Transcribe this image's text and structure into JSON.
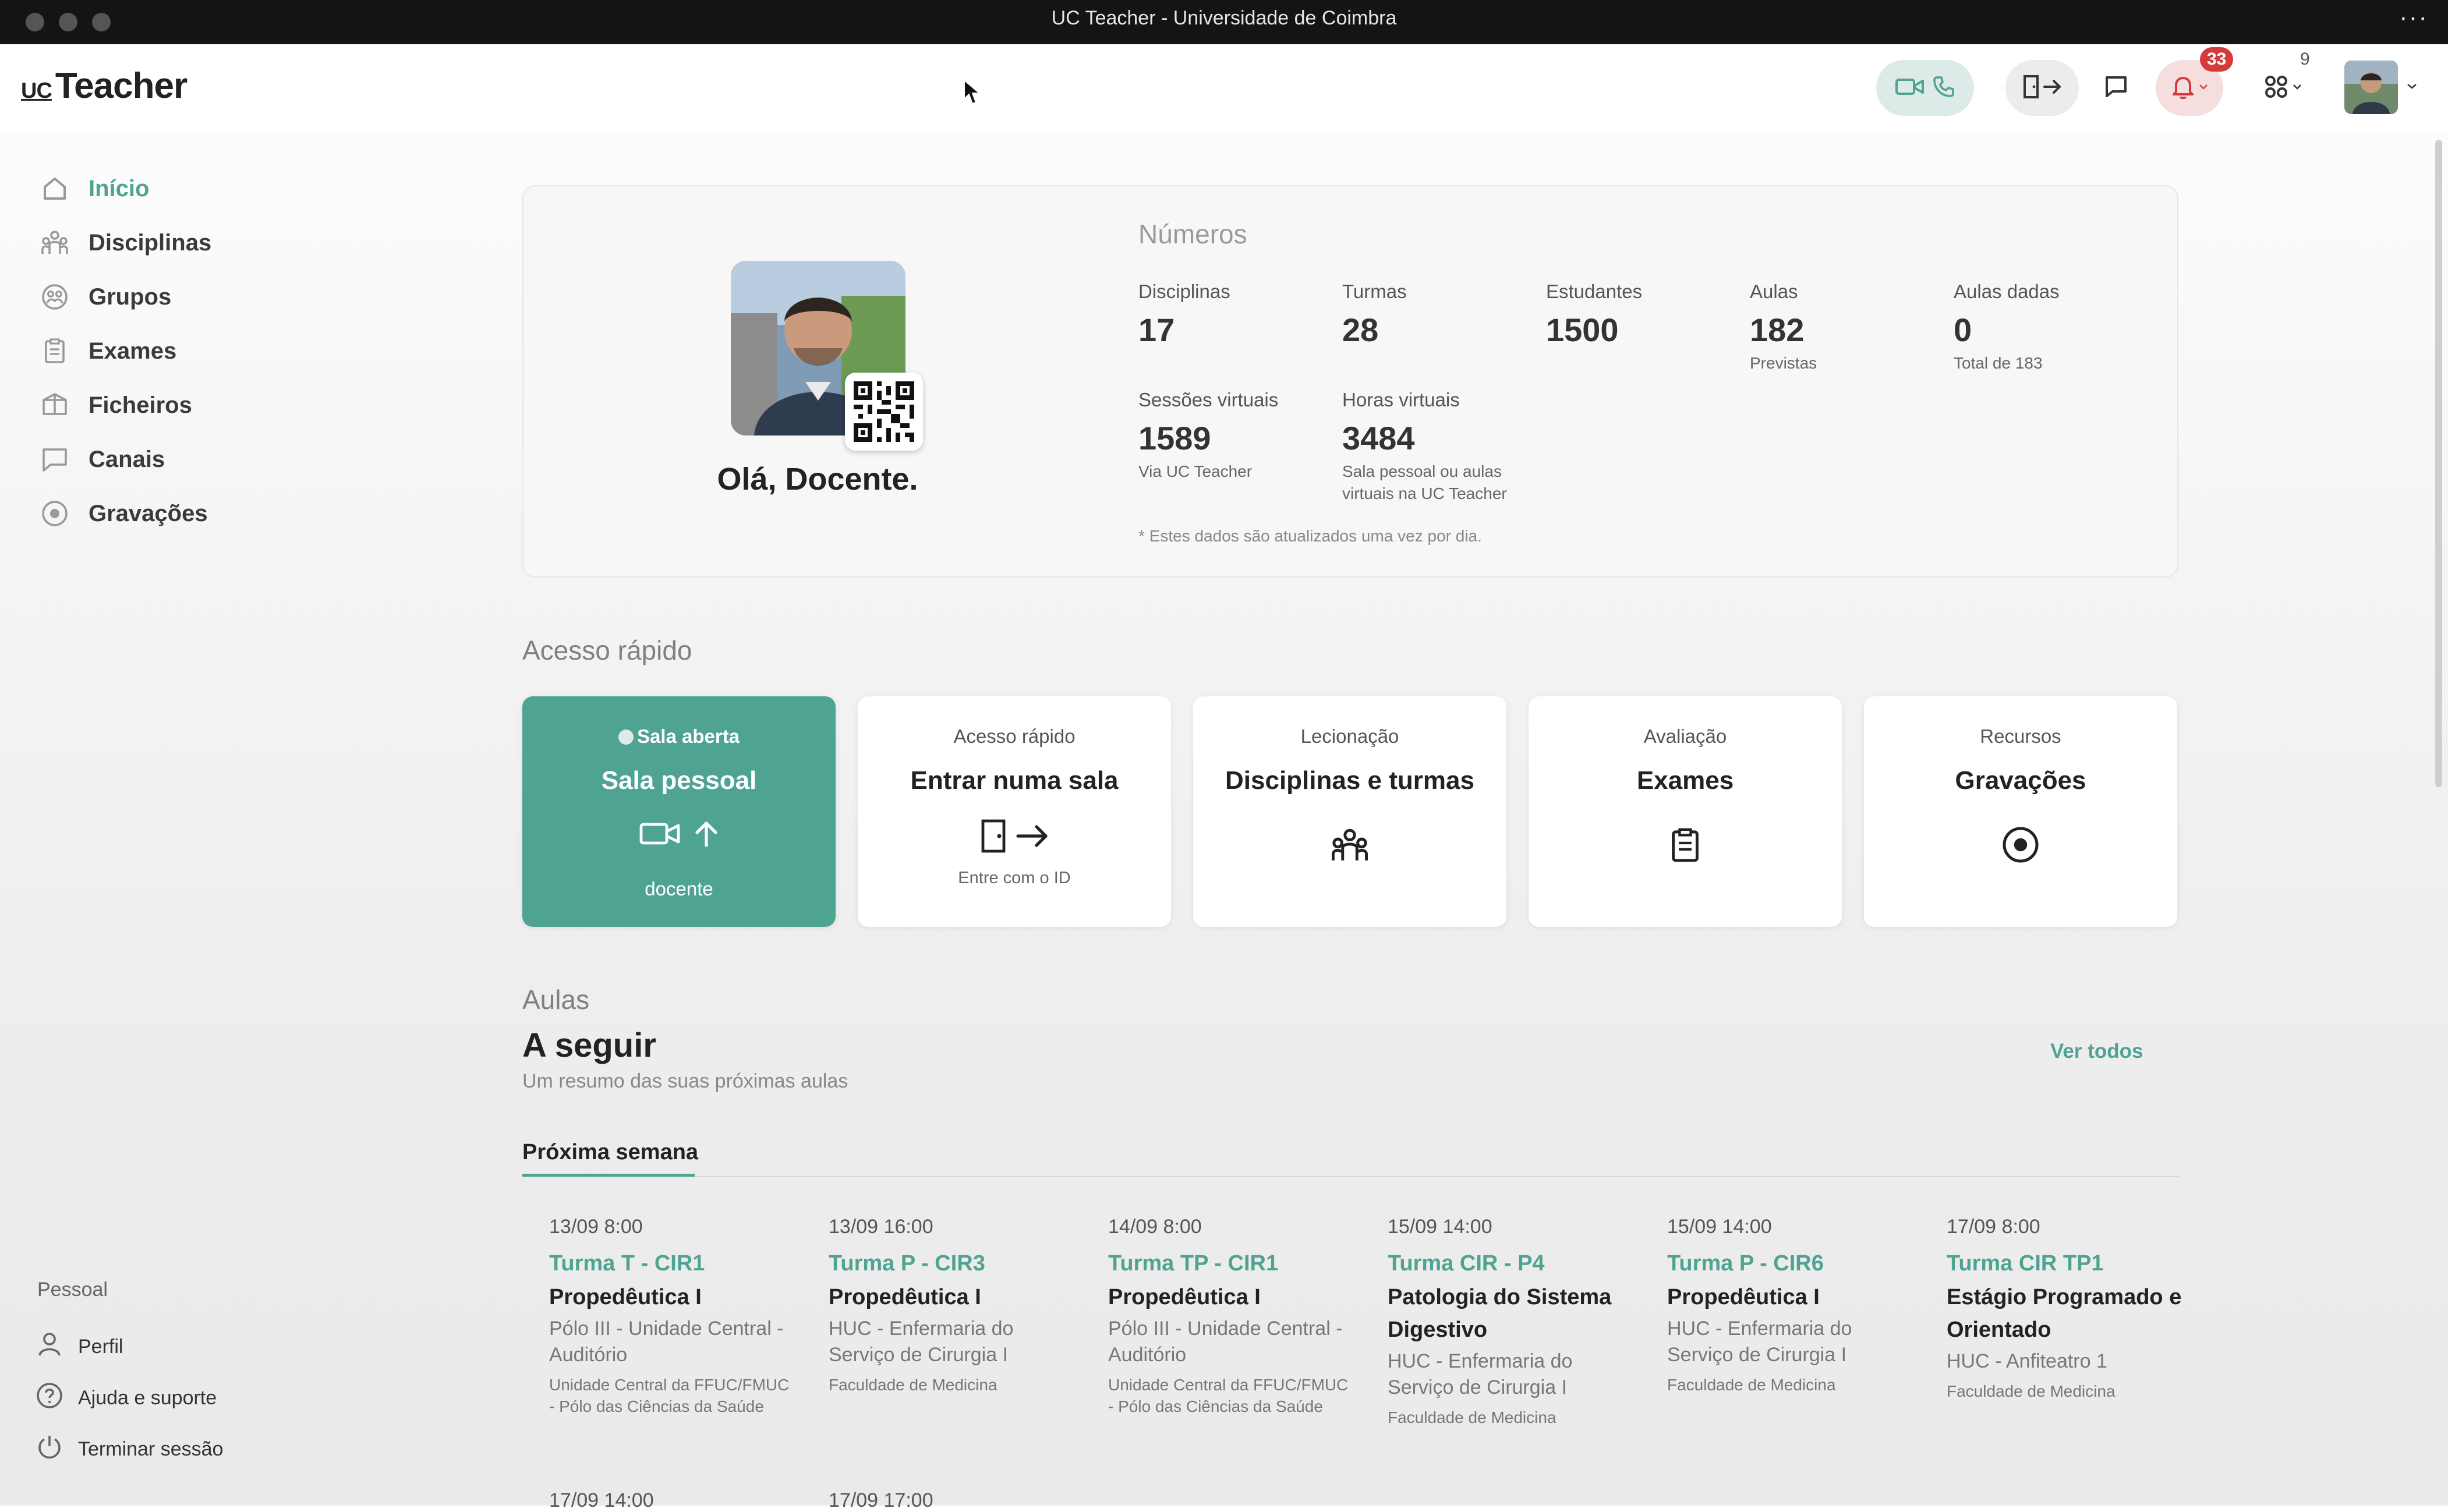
{
  "window": {
    "title": "UC Teacher - Universidade de Coimbra",
    "more": "···"
  },
  "app": {
    "logo_uc": "UC",
    "logo_text": "Teacher"
  },
  "topbar": {
    "notifications_count": "33",
    "apps_count": "9",
    "icons": [
      "video-icon",
      "phone-icon",
      "door-enter-icon",
      "chat-icon",
      "bell-icon",
      "apps-grid-icon",
      "avatar"
    ]
  },
  "sidebar": {
    "items": [
      {
        "label": "Início",
        "icon": "home-icon"
      },
      {
        "label": "Disciplinas",
        "icon": "people-icon"
      },
      {
        "label": "Grupos",
        "icon": "group-icon"
      },
      {
        "label": "Exames",
        "icon": "clipboard-icon"
      },
      {
        "label": "Ficheiros",
        "icon": "box-icon"
      },
      {
        "label": "Canais",
        "icon": "chat-icon"
      },
      {
        "label": "Gravações",
        "icon": "record-icon"
      }
    ],
    "personal_label": "Pessoal",
    "personal": [
      {
        "label": "Perfil",
        "icon": "user-icon"
      },
      {
        "label": "Ajuda e suporte",
        "icon": "help-icon"
      },
      {
        "label": "Terminar sessão",
        "icon": "power-icon"
      }
    ]
  },
  "profile": {
    "greeting": "Olá, Docente."
  },
  "stats": {
    "heading": "Números",
    "items": [
      {
        "label": "Disciplinas",
        "value": "17",
        "sub": ""
      },
      {
        "label": "Turmas",
        "value": "28",
        "sub": ""
      },
      {
        "label": "Estudantes",
        "value": "1500",
        "sub": ""
      },
      {
        "label": "Aulas",
        "value": "182",
        "sub": "Previstas"
      },
      {
        "label": "Aulas dadas",
        "value": "0",
        "sub": "Total de 183"
      },
      {
        "label": "Sessões virtuais",
        "value": "1589",
        "sub": "Via UC Teacher"
      },
      {
        "label": "Horas virtuais",
        "value": "3484",
        "sub1": "Sala pessoal ou aulas",
        "sub2": "virtuais na UC Teacher"
      }
    ],
    "note": "* Estes dados são atualizados uma vez por dia."
  },
  "quick_access": {
    "title": "Acesso rápido",
    "cards": [
      {
        "small": "Sala aberta",
        "big": "Sala pessoal",
        "footer": "docente",
        "icon": "video-upload-icon"
      },
      {
        "small": "Acesso rápido",
        "big": "Entrar numa sala",
        "footer": "Entre com o ID",
        "icon": "door-enter-icon"
      },
      {
        "small": "Lecionação",
        "big": "Disciplinas e turmas",
        "footer": "",
        "icon": "people-icon"
      },
      {
        "small": "Avaliação",
        "big": "Exames",
        "footer": "",
        "icon": "clipboard-icon"
      },
      {
        "small": "Recursos",
        "big": "Gravações",
        "footer": "",
        "icon": "record-icon"
      }
    ]
  },
  "aulas": {
    "section": "Aulas",
    "title": "A seguir",
    "subtitle": "Um resumo das suas próximas aulas",
    "ver_todos": "Ver todos",
    "tab": "Próxima semana",
    "lessons": [
      {
        "time": "13/09 8:00",
        "turma": "Turma T - CIR1",
        "subject": "Propedêutica I",
        "room": "Pólo III - Unidade Central - Auditório",
        "faculty": "Unidade Central da FFUC/FMUC - Pólo das Ciências da Saúde"
      },
      {
        "time": "13/09 16:00",
        "turma": "Turma P - CIR3",
        "subject": "Propedêutica I",
        "room": "HUC - Enfermaria do Serviço de Cirurgia I",
        "faculty": "Faculdade de Medicina"
      },
      {
        "time": "14/09 8:00",
        "turma": "Turma TP - CIR1",
        "subject": "Propedêutica I",
        "room": "Pólo III - Unidade Central - Auditório",
        "faculty": "Unidade Central da FFUC/FMUC - Pólo das Ciências da Saúde"
      },
      {
        "time": "15/09 14:00",
        "turma": "Turma CIR - P4",
        "subject": "Patologia do Sistema Digestivo",
        "room": "HUC - Enfermaria do Serviço de Cirurgia I",
        "faculty": "Faculdade de Medicina"
      },
      {
        "time": "15/09 14:00",
        "turma": "Turma P - CIR6",
        "subject": "Propedêutica I",
        "room": "HUC - Enfermaria do Serviço de Cirurgia I",
        "faculty": "Faculdade de Medicina"
      },
      {
        "time": "17/09 8:00",
        "turma": "Turma CIR TP1",
        "subject": "Estágio Programado e Orientado",
        "room": "HUC - Anfiteatro 1",
        "faculty": "Faculdade de Medicina"
      }
    ],
    "next_row": [
      "17/09 14:00",
      "17/09 17:00"
    ]
  },
  "colors": {
    "accent": "#4ea391",
    "badge": "#d63b3b",
    "titlebar": "#141414"
  }
}
